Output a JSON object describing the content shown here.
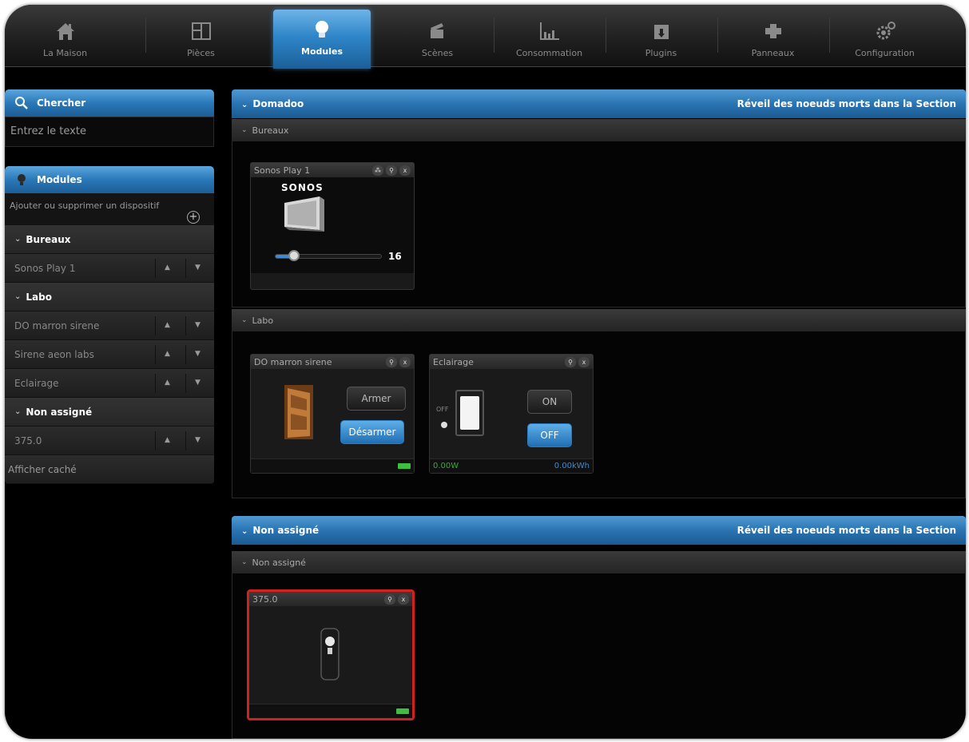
{
  "nav": {
    "items": [
      {
        "label": "La Maison",
        "icon": "house-icon"
      },
      {
        "label": "Pièces",
        "icon": "rooms-icon"
      },
      {
        "label": "Modules",
        "icon": "lightbulb-icon",
        "active": true
      },
      {
        "label": "Scènes",
        "icon": "clapperboard-icon"
      },
      {
        "label": "Consommation",
        "icon": "bar-chart-icon"
      },
      {
        "label": "Plugins",
        "icon": "plugin-box-icon"
      },
      {
        "label": "Panneaux",
        "icon": "puzzle-icon"
      },
      {
        "label": "Configuration",
        "icon": "gears-icon"
      }
    ]
  },
  "sidebar": {
    "search": {
      "title": "Chercher",
      "placeholder": "Entrez le texte"
    },
    "modules": {
      "title": "Modules",
      "add_label": "Ajouter ou supprimer un dispositif",
      "groups": [
        {
          "name": "Bureaux",
          "devices": [
            "Sonos Play 1"
          ]
        },
        {
          "name": "Labo",
          "devices": [
            "DO marron sirene",
            "Sirene aeon labs",
            "Eclairage"
          ]
        },
        {
          "name": "Non assigné",
          "devices": [
            "375.0"
          ]
        }
      ],
      "show_hidden": "Afficher caché"
    }
  },
  "main": {
    "sections": [
      {
        "title": "Domadoo",
        "wake_label": "Réveil des noeuds morts dans la Section",
        "rooms": [
          "Bureaux",
          "Labo"
        ]
      },
      {
        "title": "Non assigné",
        "wake_label": "Réveil des noeuds morts dans la Section",
        "rooms": [
          "Non assigné"
        ]
      }
    ],
    "cards": {
      "sonos": {
        "title": "Sonos Play 1",
        "brand": "SONOS",
        "volume": "16",
        "volume_level": 0.12
      },
      "door": {
        "title": "DO marron sirene",
        "arm": "Armer",
        "disarm": "Désarmer"
      },
      "light": {
        "title": "Eclairage",
        "state_label": "OFF",
        "on": "ON",
        "off": "OFF",
        "power": "0.00W",
        "energy": "0.00kWh"
      },
      "remote": {
        "title": "375.0"
      }
    }
  },
  "colors": {
    "accent": "#2a78b8",
    "battery": "#3fbf3f",
    "alert_border": "#d02020"
  }
}
